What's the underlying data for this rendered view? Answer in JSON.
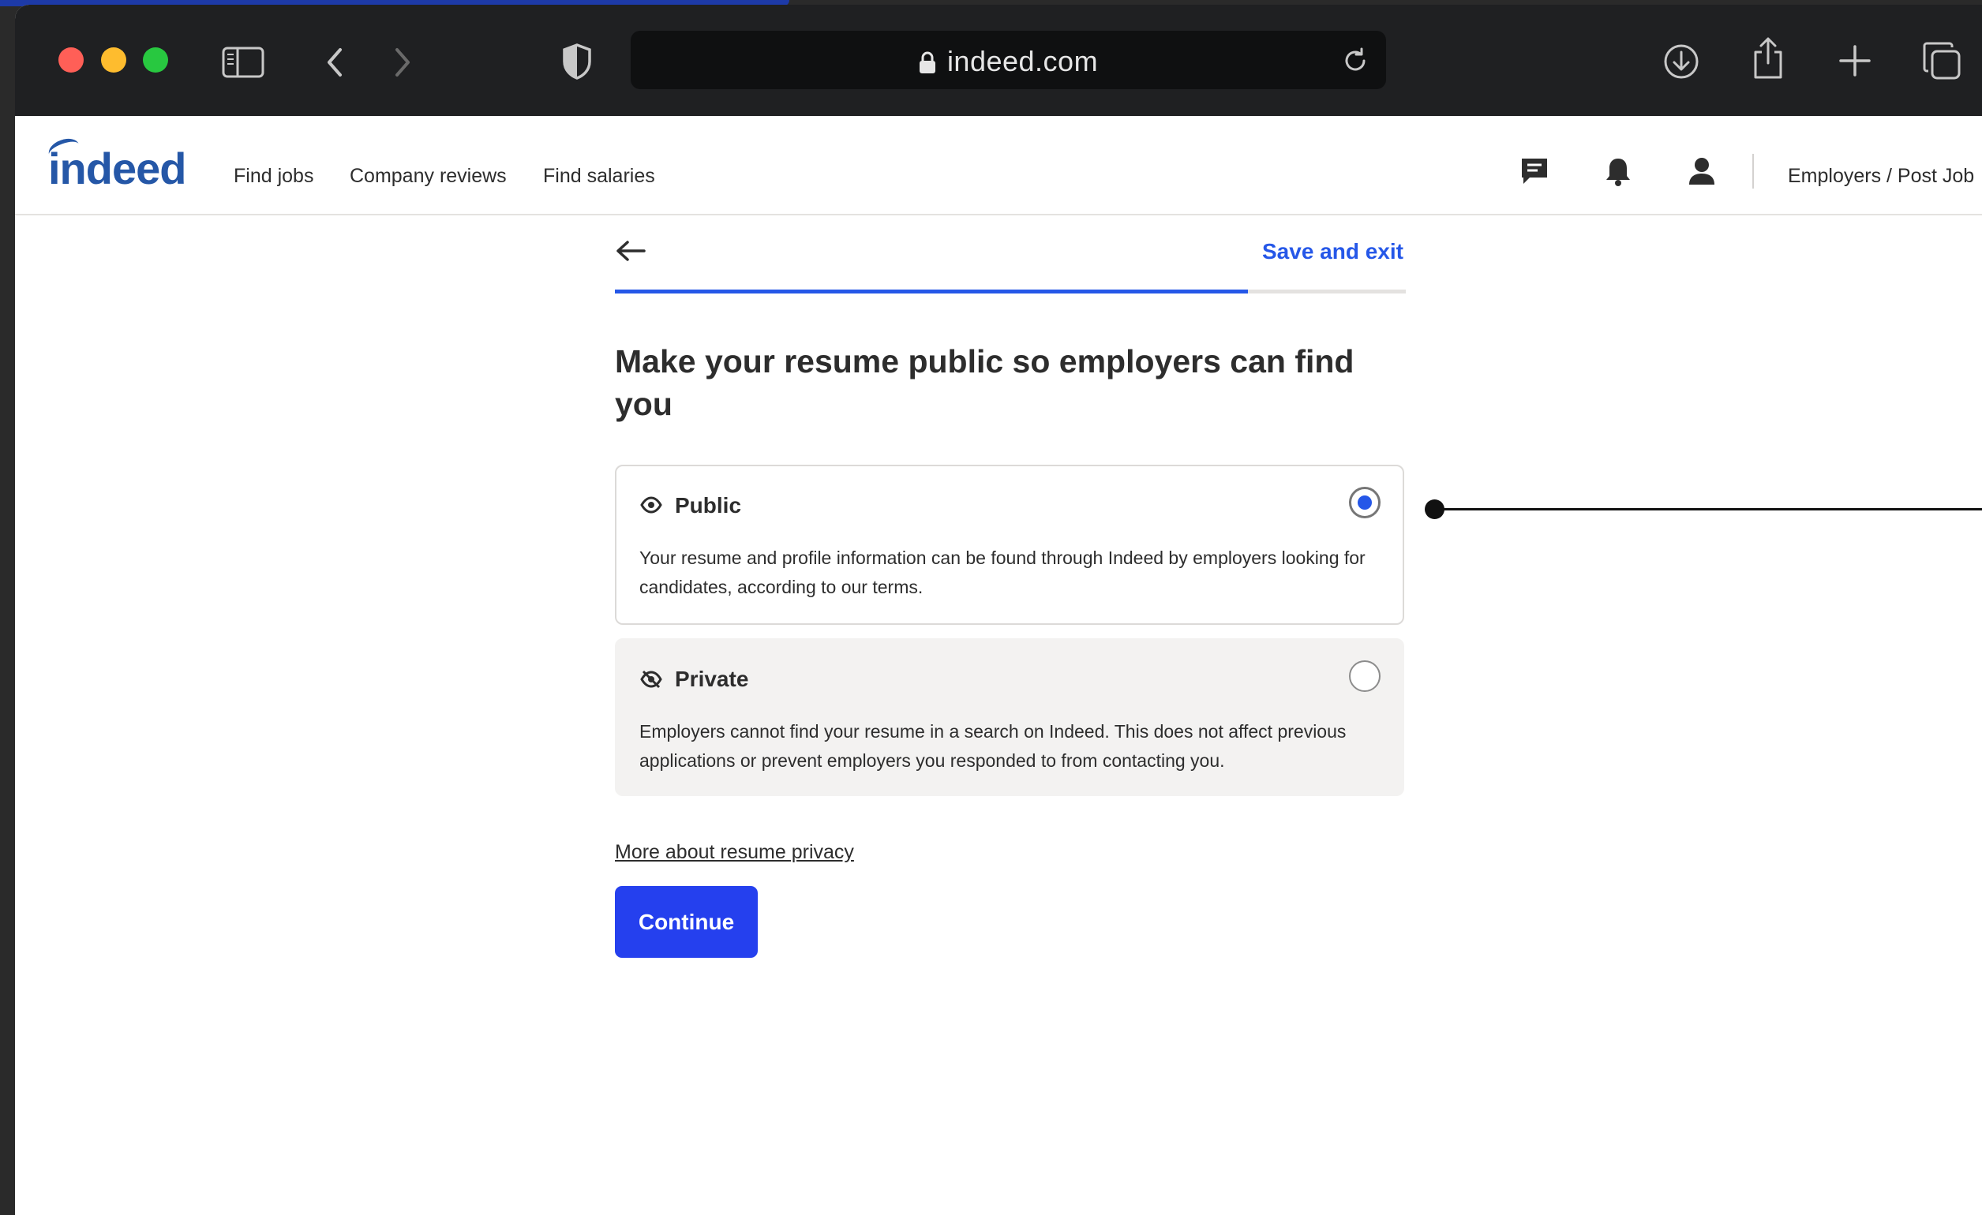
{
  "browser": {
    "url": "indeed.com"
  },
  "header": {
    "logo": "indeed",
    "nav": [
      "Find jobs",
      "Company reviews",
      "Find salaries"
    ],
    "employers_link": "Employers / Post Job"
  },
  "flow": {
    "save_exit": "Save and exit",
    "progress": 0.8,
    "title": "Make your resume public so employers can find you",
    "options": [
      {
        "label": "Public",
        "icon": "eye-icon",
        "description": "Your resume and profile information can be found through Indeed by employers looking for candidates, according to our terms.",
        "selected": true
      },
      {
        "label": "Private",
        "icon": "eye-off-icon",
        "description": "Employers cannot find your resume in a search on Indeed. This does not affect previous applications or prevent employers you responded to from contacting you.",
        "selected": false
      }
    ],
    "privacy_link": "More about resume privacy",
    "continue_label": "Continue"
  },
  "colors": {
    "accent": "#2557e8",
    "button": "#2540ee",
    "logo": "#2557a7"
  }
}
